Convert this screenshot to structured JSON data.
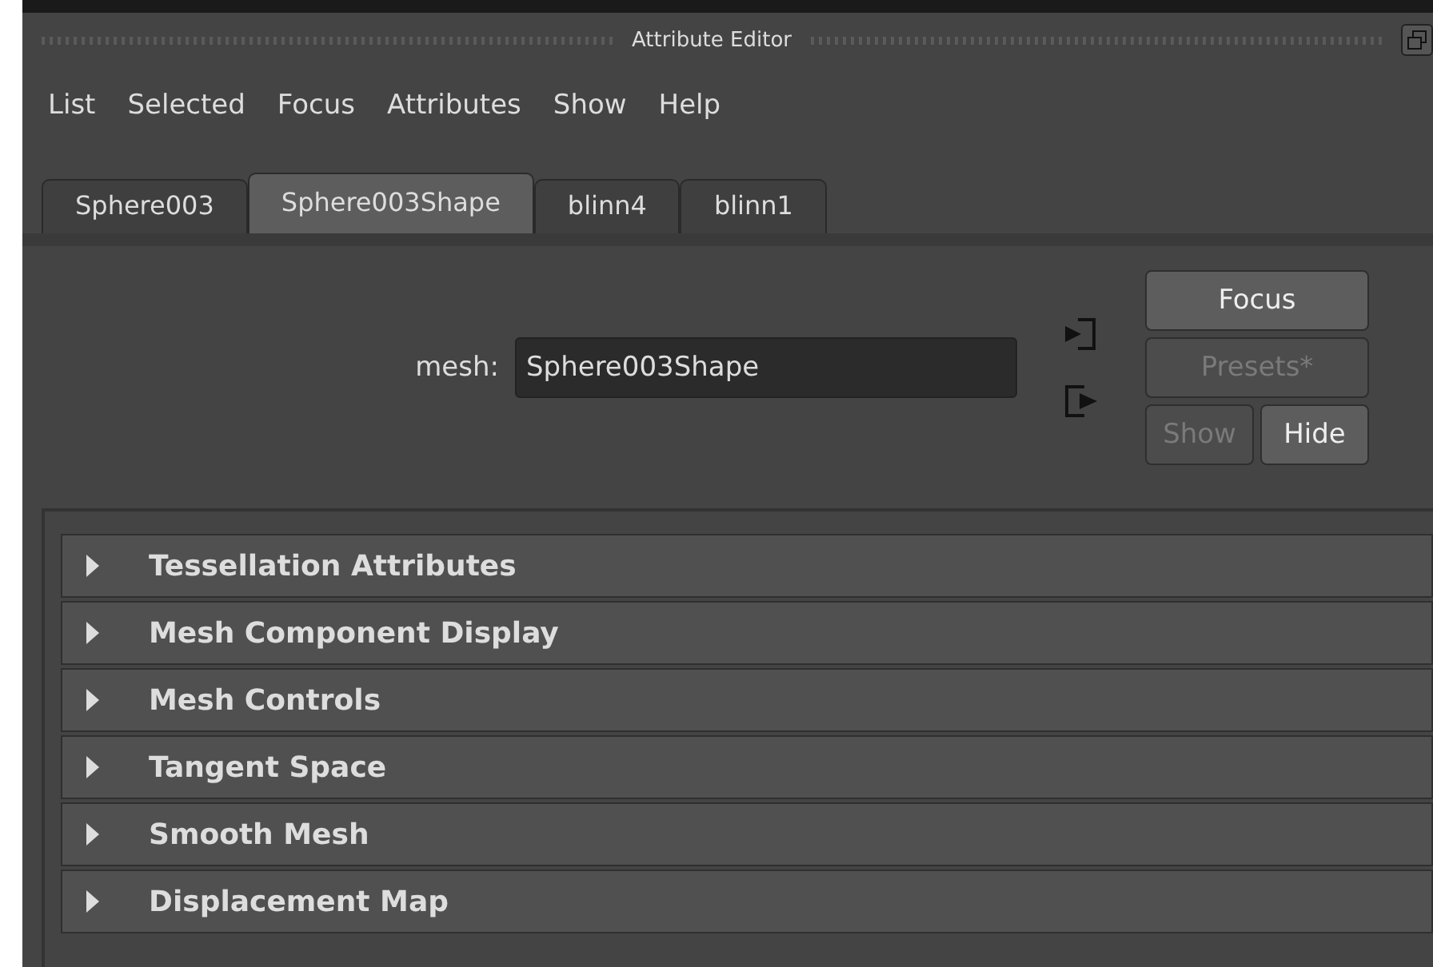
{
  "window": {
    "title": "Attribute Editor"
  },
  "menu": [
    "List",
    "Selected",
    "Focus",
    "Attributes",
    "Show",
    "Help"
  ],
  "tabs": [
    {
      "label": "Sphere003",
      "selected": false
    },
    {
      "label": "Sphere003Shape",
      "selected": true
    },
    {
      "label": "blinn4",
      "selected": false
    },
    {
      "label": "blinn1",
      "selected": false
    }
  ],
  "node": {
    "label": "mesh:",
    "value": "Sphere003Shape"
  },
  "buttons": [
    {
      "label": "Focus",
      "disabled": false
    },
    {
      "label": "Presets*",
      "disabled": true
    },
    {
      "label": "Show",
      "disabled": true
    },
    {
      "label": "Hide",
      "disabled": false
    }
  ],
  "sections": [
    {
      "label": "Tessellation Attributes",
      "expanded": false
    },
    {
      "label": "Mesh Component Display",
      "expanded": false
    },
    {
      "label": "Mesh Controls",
      "expanded": false
    },
    {
      "label": "Tangent Space",
      "expanded": false
    },
    {
      "label": "Smooth Mesh",
      "expanded": false
    },
    {
      "label": "Displacement Map",
      "expanded": false
    }
  ]
}
